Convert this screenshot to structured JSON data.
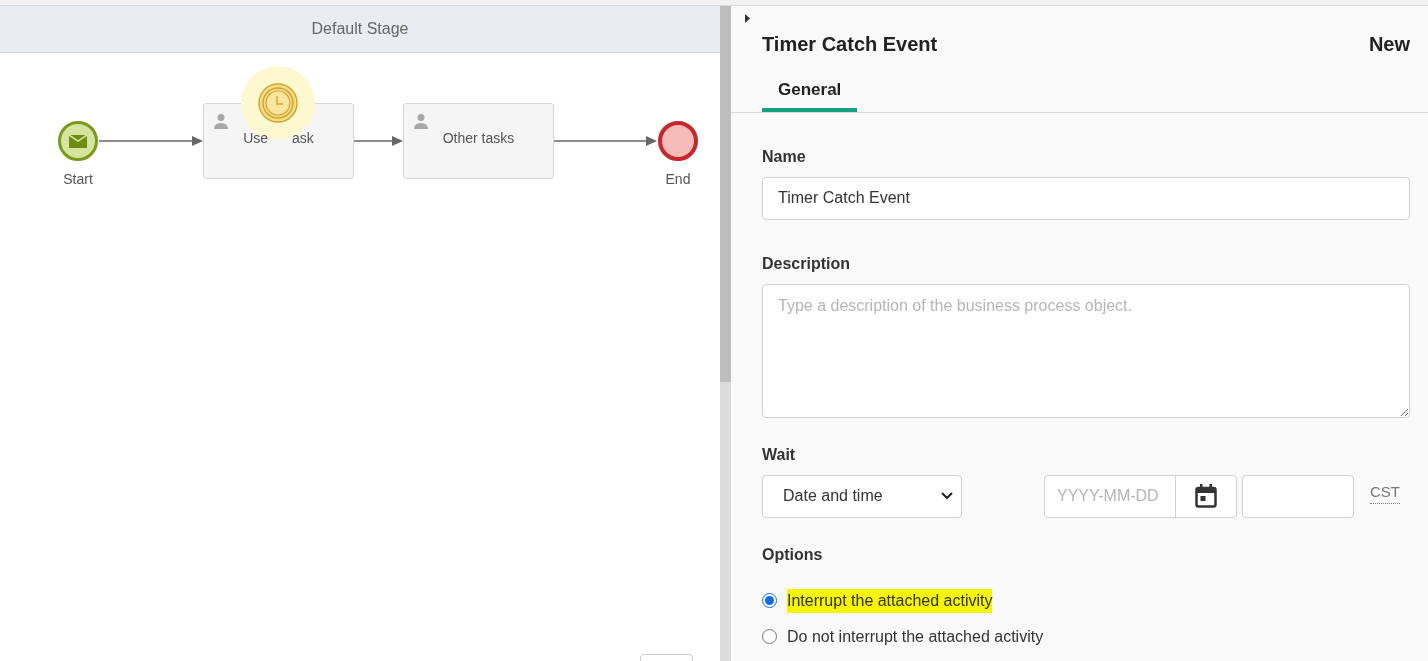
{
  "stage": {
    "title": "Default Stage"
  },
  "diagram": {
    "nodes": [
      {
        "kind": "start",
        "label": "Start"
      },
      {
        "kind": "task",
        "label_parts": [
          "Use",
          "ask"
        ],
        "timer": true
      },
      {
        "kind": "task",
        "label_parts": [
          "Other tasks"
        ],
        "timer": false
      },
      {
        "kind": "end",
        "label": "End"
      }
    ]
  },
  "panel": {
    "title": "Timer Catch Event",
    "status": "New",
    "tabs": [
      {
        "label": "General",
        "selected": true
      }
    ],
    "name": {
      "label": "Name",
      "value": "Timer Catch Event"
    },
    "description": {
      "label": "Description",
      "placeholder": "Type a description of the business process object."
    },
    "wait": {
      "label": "Wait",
      "mode": "Date and time",
      "date_placeholder": "YYYY-MM-DD",
      "timezone": "CST"
    },
    "options": {
      "label": "Options",
      "items": [
        {
          "label": "Interrupt the attached activity",
          "selected": true,
          "highlighted": true
        },
        {
          "label": "Do not interrupt the attached activity",
          "selected": false,
          "highlighted": false
        }
      ]
    }
  }
}
